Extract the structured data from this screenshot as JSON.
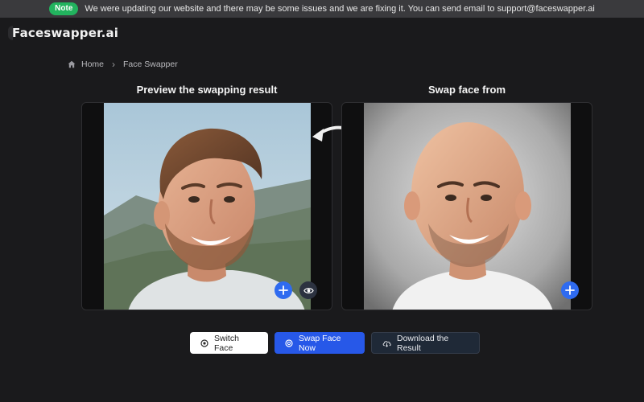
{
  "notice": {
    "badge": "Note",
    "message": "We were updating our website and there may be some issues and we are fixing it. You can send email to support@faceswapper.ai"
  },
  "brand": {
    "name": "Faceswapper.ai"
  },
  "breadcrumb": {
    "home": "Home",
    "current": "Face Swapper"
  },
  "panels": {
    "left_title": "Preview the swapping result",
    "right_title": "Swap face from"
  },
  "actions": {
    "switch_label": "Switch Face",
    "swap_label": "Swap Face Now",
    "download_label": "Download the Result"
  },
  "icons": {
    "home": "home-icon",
    "add": "plus-icon",
    "preview": "eye-icon",
    "switch": "switch-icon",
    "swap": "swap-icon",
    "download": "cloud-download-icon",
    "arrow": "curved-arrow-left-icon"
  },
  "colors": {
    "note_badge": "#22b35e",
    "primary": "#2758e8",
    "add_button": "#2f6bf0"
  }
}
